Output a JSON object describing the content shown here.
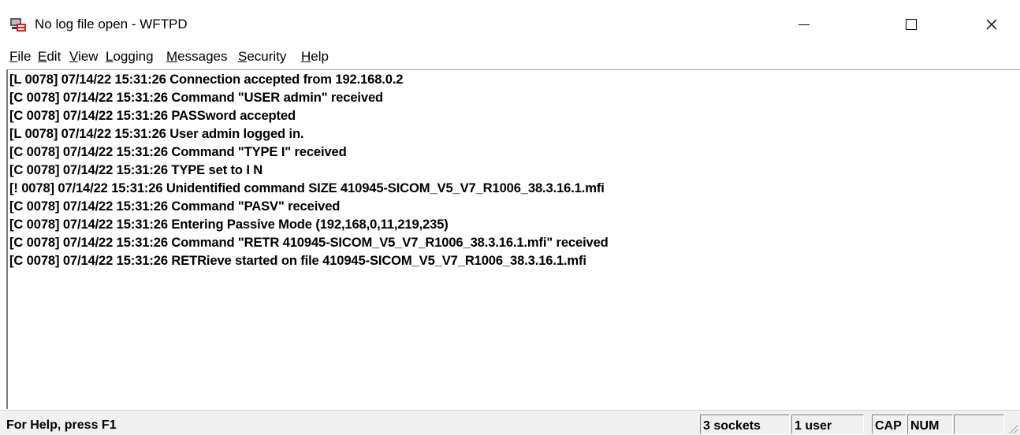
{
  "window": {
    "title": "No log file open - WFTPD",
    "app_icon": "wftpd-app-icon",
    "controls": {
      "minimize": "minimize-icon",
      "maximize": "maximize-icon",
      "close_glyph": "✕"
    }
  },
  "menu": {
    "items": [
      {
        "label": "File"
      },
      {
        "label": "Edit"
      },
      {
        "label": "View"
      },
      {
        "label": "Logging"
      },
      {
        "label": "Messages"
      },
      {
        "label": "Security"
      },
      {
        "label": "Help"
      }
    ]
  },
  "log": {
    "lines": [
      "[L 0078] 07/14/22 15:31:26 Connection accepted from 192.168.0.2",
      "[C 0078] 07/14/22 15:31:26 Command \"USER admin\" received",
      "[C 0078] 07/14/22 15:31:26 PASSword accepted",
      "[L 0078] 07/14/22 15:31:26 User admin logged in.",
      "[C 0078] 07/14/22 15:31:26 Command \"TYPE I\" received",
      "[C 0078] 07/14/22 15:31:26 TYPE set to I N",
      "[! 0078] 07/14/22 15:31:26 Unidentified command SIZE 410945-SICOM_V5_V7_R1006_38.3.16.1.mfi",
      "[C 0078] 07/14/22 15:31:26 Command \"PASV\" received",
      "[C 0078] 07/14/22 15:31:26 Entering Passive Mode (192,168,0,11,219,235)",
      "[C 0078] 07/14/22 15:31:26 Command \"RETR 410945-SICOM_V5_V7_R1006_38.3.16.1.mfi\" received",
      "[C 0078] 07/14/22 15:31:26 RETRieve started on file 410945-SICOM_V5_V7_R1006_38.3.16.1.mfi"
    ]
  },
  "status": {
    "help": "For Help, press F1",
    "sockets": "3 sockets",
    "users": "1 user",
    "cap": "CAP",
    "num": "NUM",
    "scroll": ""
  }
}
